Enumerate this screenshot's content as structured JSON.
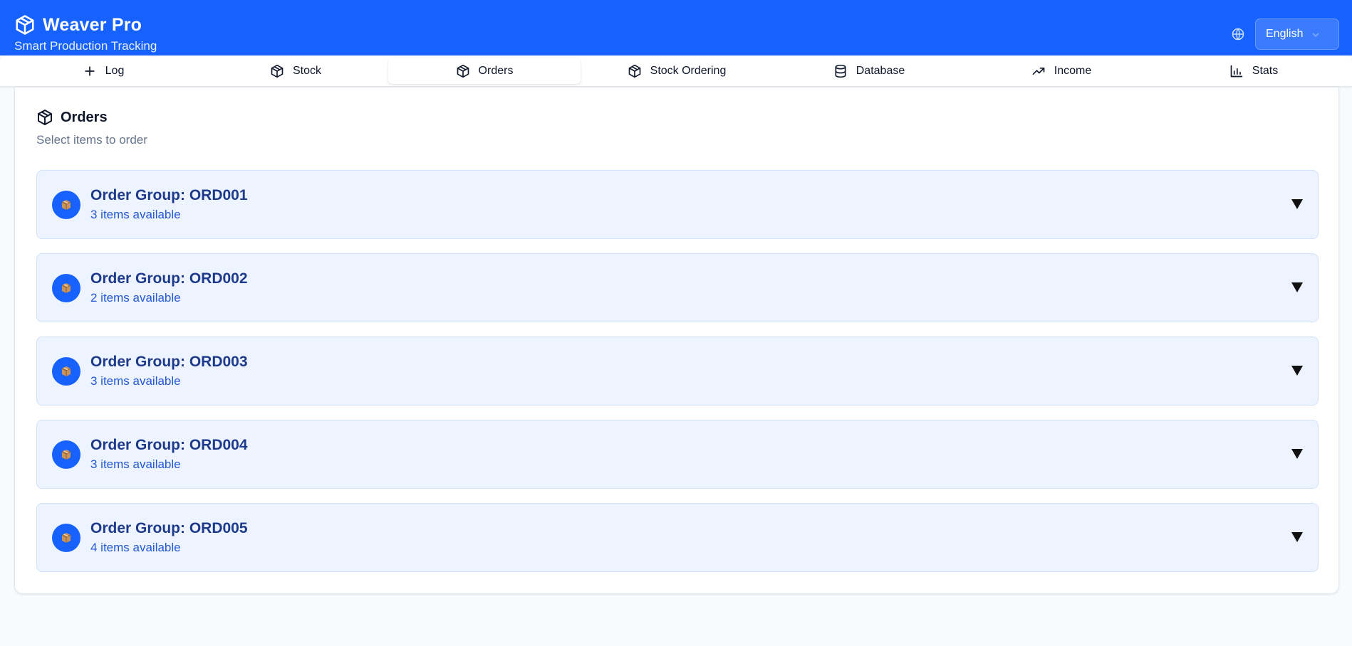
{
  "app": {
    "title": "Weaver Pro",
    "subtitle": "Smart Production Tracking",
    "language": "English"
  },
  "nav": {
    "tabs": [
      {
        "label": "Log",
        "icon": "plus-icon",
        "active": false
      },
      {
        "label": "Stock",
        "icon": "box-icon",
        "active": false
      },
      {
        "label": "Orders",
        "icon": "box-icon",
        "active": true
      },
      {
        "label": "Stock Ordering",
        "icon": "box-icon",
        "active": false
      },
      {
        "label": "Database",
        "icon": "database-icon",
        "active": false
      },
      {
        "label": "Income",
        "icon": "trending-up-icon",
        "active": false
      },
      {
        "label": "Stats",
        "icon": "bar-chart-icon",
        "active": false
      }
    ]
  },
  "orders": {
    "title": "Orders",
    "subtitle": "Select items to order",
    "groups": [
      {
        "title": "Order Group: ORD001",
        "count": "3 items available"
      },
      {
        "title": "Order Group: ORD002",
        "count": "2 items available"
      },
      {
        "title": "Order Group: ORD003",
        "count": "3 items available"
      },
      {
        "title": "Order Group: ORD004",
        "count": "3 items available"
      },
      {
        "title": "Order Group: ORD005",
        "count": "4 items available"
      }
    ]
  },
  "colors": {
    "brand": "#1762fe",
    "group_bg": "#edf4ff",
    "group_title": "#1e3a8a",
    "group_sub": "#2357d6"
  }
}
